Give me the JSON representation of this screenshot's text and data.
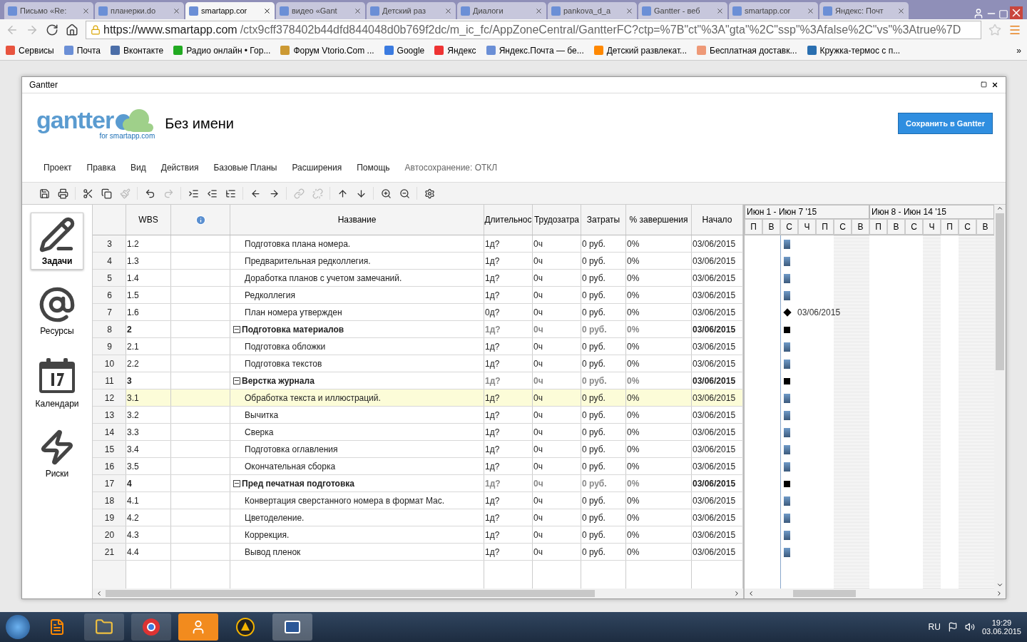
{
  "browser": {
    "tabs": [
      {
        "title": "Письмо «Re:",
        "selected": false
      },
      {
        "title": "планерки.do",
        "selected": false
      },
      {
        "title": "smartapp.cor",
        "selected": true
      },
      {
        "title": "видео «Gant",
        "selected": false
      },
      {
        "title": "Детский раз",
        "selected": false
      },
      {
        "title": "Диалоги",
        "selected": false
      },
      {
        "title": "pankova_d_a",
        "selected": false
      },
      {
        "title": "Gantter - веб",
        "selected": false
      },
      {
        "title": "smartapp.cor",
        "selected": false
      },
      {
        "title": "Яндекс: Почт",
        "selected": false
      }
    ],
    "url_host": "https://www.smartapp.com",
    "url_path": "/ctx9cff378402b44dfd844048d0b769f2dc/m_ic_fc/AppZoneCentral/GantterFC?ctp=%7B\"ct\"%3A\"gta\"%2C\"ssp\"%3Afalse%2C\"vs\"%3Atrue%7D",
    "bookmarks": [
      "Сервисы",
      "Почта",
      "Вконтакте",
      "Радио онлайн • Гор...",
      "Форум Vtorio.Com ...",
      "Google",
      "Яндекс",
      "Яндекс.Почта — бе...",
      "Детский развлекат...",
      "Бесплатная доставк...",
      "Кружка-термос с п..."
    ],
    "bookmarks_more": "»"
  },
  "window": {
    "title": "Gantter"
  },
  "header": {
    "logo": "gantter",
    "tagline": "for smartapp.com",
    "project_title": "Без имени",
    "save_button": "Сохранить в Gantter"
  },
  "menu": {
    "items": [
      "Проект",
      "Правка",
      "Вид",
      "Действия",
      "Базовые Планы",
      "Расширения",
      "Помощь"
    ],
    "autosave": "Автосохранение: ОТКЛ"
  },
  "toolbar": [
    [
      {
        "disabled": false
      },
      {
        "disabled": false
      }
    ],
    [
      {
        "disabled": false
      },
      {
        "disabled": false
      },
      {
        "disabled": true
      }
    ],
    [
      {
        "disabled": false
      },
      {
        "disabled": true
      }
    ],
    [
      {
        "disabled": false
      },
      {
        "disabled": false
      },
      {
        "disabled": false
      }
    ],
    [
      {
        "disabled": false
      },
      {
        "disabled": false
      }
    ],
    [
      {
        "disabled": true
      },
      {
        "disabled": true
      }
    ],
    [
      {
        "disabled": false
      },
      {
        "disabled": false
      }
    ],
    [
      {
        "disabled": false
      },
      {
        "disabled": false
      }
    ],
    [
      {
        "disabled": false
      }
    ]
  ],
  "sidebar": {
    "items": [
      {
        "label": "Задачи",
        "selected": true
      },
      {
        "label": "Ресурсы",
        "selected": false
      },
      {
        "label": "Календари",
        "selected": false
      },
      {
        "label": "Риски",
        "selected": false
      }
    ]
  },
  "table": {
    "columns": [
      "WBS",
      "Название",
      "Длительнос",
      "Трудозатра",
      "Затраты",
      "% завершения",
      "Начало"
    ],
    "rows": [
      {
        "num": "3",
        "wbs": "1.2",
        "name": "Подготовка плана номера.",
        "duration": "1д?",
        "work": "0ч",
        "cost": "0 руб.",
        "complete": "0%",
        "start": "03/06/2015",
        "summary": false,
        "selected": false,
        "kind": "task"
      },
      {
        "num": "4",
        "wbs": "1.3",
        "name": "Предварительная редколлегия.",
        "duration": "1д?",
        "work": "0ч",
        "cost": "0 руб.",
        "complete": "0%",
        "start": "03/06/2015",
        "summary": false,
        "selected": false,
        "kind": "task"
      },
      {
        "num": "5",
        "wbs": "1.4",
        "name": "Доработка планов с учетом замечаний.",
        "duration": "1д?",
        "work": "0ч",
        "cost": "0 руб.",
        "complete": "0%",
        "start": "03/06/2015",
        "summary": false,
        "selected": false,
        "kind": "task"
      },
      {
        "num": "6",
        "wbs": "1.5",
        "name": "Редколлегия",
        "duration": "1д?",
        "work": "0ч",
        "cost": "0 руб.",
        "complete": "0%",
        "start": "03/06/2015",
        "summary": false,
        "selected": false,
        "kind": "task"
      },
      {
        "num": "7",
        "wbs": "1.6",
        "name": "План номера утвержден",
        "duration": "0д?",
        "work": "0ч",
        "cost": "0 руб.",
        "complete": "0%",
        "start": "03/06/2015",
        "summary": false,
        "selected": false,
        "kind": "milestone",
        "bar_label": "03/06/2015"
      },
      {
        "num": "8",
        "wbs": "2",
        "name": "Подготовка материалов",
        "duration": "1д?",
        "work": "0ч",
        "cost": "0 руб.",
        "complete": "0%",
        "start": "03/06/2015",
        "summary": true,
        "selected": false,
        "kind": "summary"
      },
      {
        "num": "9",
        "wbs": "2.1",
        "name": "Подготовка обложки",
        "duration": "1д?",
        "work": "0ч",
        "cost": "0 руб.",
        "complete": "0%",
        "start": "03/06/2015",
        "summary": false,
        "selected": false,
        "kind": "task"
      },
      {
        "num": "10",
        "wbs": "2.2",
        "name": "Подготовка текстов",
        "duration": "1д?",
        "work": "0ч",
        "cost": "0 руб.",
        "complete": "0%",
        "start": "03/06/2015",
        "summary": false,
        "selected": false,
        "kind": "task"
      },
      {
        "num": "11",
        "wbs": "3",
        "name": "Верстка журнала",
        "duration": "1д?",
        "work": "0ч",
        "cost": "0 руб.",
        "complete": "0%",
        "start": "03/06/2015",
        "summary": true,
        "selected": false,
        "kind": "summary"
      },
      {
        "num": "12",
        "wbs": "3.1",
        "name": "Обработка текста и иллюстраций.",
        "duration": "1д?",
        "work": "0ч",
        "cost": "0 руб.",
        "complete": "0%",
        "start": "03/06/2015",
        "summary": false,
        "selected": true,
        "kind": "task"
      },
      {
        "num": "13",
        "wbs": "3.2",
        "name": "Вычитка",
        "duration": "1д?",
        "work": "0ч",
        "cost": "0 руб.",
        "complete": "0%",
        "start": "03/06/2015",
        "summary": false,
        "selected": false,
        "kind": "task"
      },
      {
        "num": "14",
        "wbs": "3.3",
        "name": "Сверка",
        "duration": "1д?",
        "work": "0ч",
        "cost": "0 руб.",
        "complete": "0%",
        "start": "03/06/2015",
        "summary": false,
        "selected": false,
        "kind": "task"
      },
      {
        "num": "15",
        "wbs": "3.4",
        "name": "Подготовка оглавления",
        "duration": "1д?",
        "work": "0ч",
        "cost": "0 руб.",
        "complete": "0%",
        "start": "03/06/2015",
        "summary": false,
        "selected": false,
        "kind": "task"
      },
      {
        "num": "16",
        "wbs": "3.5",
        "name": "Окончательная сборка",
        "duration": "1д?",
        "work": "0ч",
        "cost": "0 руб.",
        "complete": "0%",
        "start": "03/06/2015",
        "summary": false,
        "selected": false,
        "kind": "task"
      },
      {
        "num": "17",
        "wbs": "4",
        "name": "Пред печатная подготовка",
        "duration": "1д?",
        "work": "0ч",
        "cost": "0 руб.",
        "complete": "0%",
        "start": "03/06/2015",
        "summary": true,
        "selected": false,
        "kind": "summary"
      },
      {
        "num": "18",
        "wbs": "4.1",
        "name": "Конвертация сверстанного номера в формат Mac.",
        "duration": "1д?",
        "work": "0ч",
        "cost": "0 руб.",
        "complete": "0%",
        "start": "03/06/2015",
        "summary": false,
        "selected": false,
        "kind": "task"
      },
      {
        "num": "19",
        "wbs": "4.2",
        "name": "Цветоделение.",
        "duration": "1д?",
        "work": "0ч",
        "cost": "0 руб.",
        "complete": "0%",
        "start": "03/06/2015",
        "summary": false,
        "selected": false,
        "kind": "task"
      },
      {
        "num": "20",
        "wbs": "4.3",
        "name": "Коррекция.",
        "duration": "1д?",
        "work": "0ч",
        "cost": "0 руб.",
        "complete": "0%",
        "start": "03/06/2015",
        "summary": false,
        "selected": false,
        "kind": "task"
      },
      {
        "num": "21",
        "wbs": "4.4",
        "name": "Вывод пленок",
        "duration": "1д?",
        "work": "0ч",
        "cost": "0 руб.",
        "complete": "0%",
        "start": "03/06/2015",
        "summary": false,
        "selected": false,
        "kind": "task"
      }
    ]
  },
  "gantt": {
    "weeks": [
      "Июн 1 - Июн 7 '15",
      "Июн 8 - Июн 14 '15"
    ],
    "days": [
      {
        "label": "П",
        "weekend": false
      },
      {
        "label": "В",
        "weekend": false
      },
      {
        "label": "С",
        "weekend": false
      },
      {
        "label": "Ч",
        "weekend": false
      },
      {
        "label": "П",
        "weekend": false
      },
      {
        "label": "С",
        "weekend": true
      },
      {
        "label": "В",
        "weekend": true
      },
      {
        "label": "П",
        "weekend": false
      },
      {
        "label": "В",
        "weekend": false
      },
      {
        "label": "С",
        "weekend": false
      },
      {
        "label": "Ч",
        "weekend": true
      },
      {
        "label": "П",
        "weekend": false
      },
      {
        "label": "С",
        "weekend": true
      },
      {
        "label": "В",
        "weekend": true
      }
    ]
  },
  "taskbar": {
    "language": "RU",
    "time": "19:29",
    "date": "03.06.2015"
  }
}
